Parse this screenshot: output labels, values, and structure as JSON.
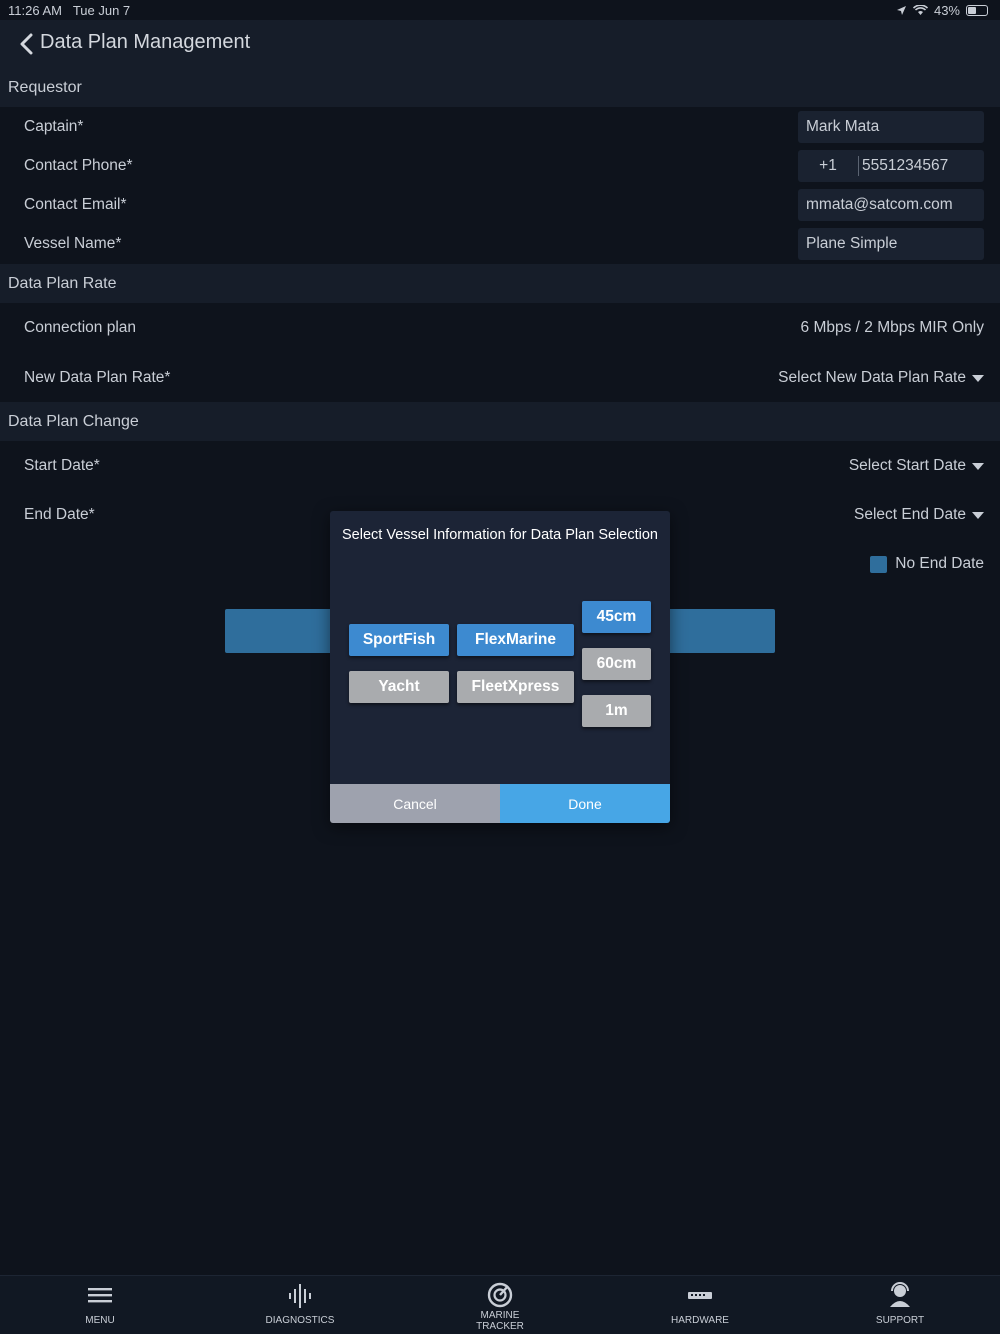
{
  "status_bar": {
    "time": "11:26 AM",
    "date": "Tue Jun 7",
    "battery": "43%"
  },
  "header": {
    "title": "Data Plan Management"
  },
  "requestor": {
    "section_title": "Requestor",
    "captain_label": "Captain*",
    "captain_value": "Mark Mata",
    "phone_label": "Contact Phone*",
    "phone_code": "+1",
    "phone_value": "5551234567",
    "email_label": "Contact Email*",
    "email_value": "mmata@satcom.com",
    "vessel_label": "Vessel Name*",
    "vessel_value": "Plane Simple"
  },
  "rate": {
    "section_title": "Data Plan Rate",
    "connection_label": "Connection plan",
    "connection_value": "6 Mbps / 2 Mbps MIR Only",
    "new_rate_label": "New Data Plan Rate*",
    "new_rate_value": "Select New Data Plan Rate"
  },
  "change": {
    "section_title": "Data Plan Change",
    "start_label": "Start Date*",
    "start_value": "Select Start Date",
    "end_label": "End Date*",
    "end_value": "Select End Date",
    "no_end_date_label": "No End Date"
  },
  "modal": {
    "title": "Select Vessel Information for Data Plan Selection",
    "options": {
      "sportfish": "SportFish",
      "flexmarine": "FlexMarine",
      "yacht": "Yacht",
      "fleetxpress": "FleetXpress",
      "size_45": "45cm",
      "size_60": "60cm",
      "size_1m": "1m"
    },
    "cancel_label": "Cancel",
    "done_label": "Done"
  },
  "tabs": {
    "menu": "MENU",
    "diagnostics": "DIAGNOSTICS",
    "tracker_line1": "MARINE",
    "tracker_line2": "TRACKER",
    "hardware": "HARDWARE",
    "support": "SUPPORT"
  },
  "colors": {
    "accent_active": "#3d8ad0",
    "done_button": "#47a6e6",
    "inactive_button": "#a9abae",
    "background": "#0e131c"
  }
}
